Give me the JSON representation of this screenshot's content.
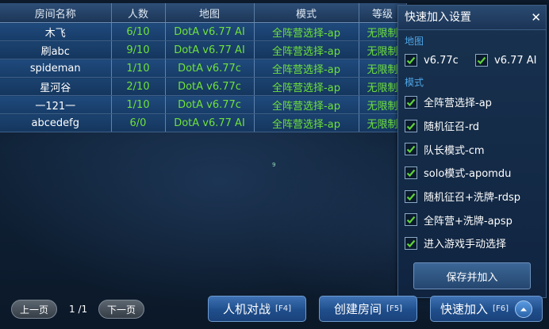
{
  "table": {
    "headers": [
      "房间名称",
      "人数",
      "地图",
      "模式",
      "等级"
    ],
    "rows": [
      {
        "name": "木飞",
        "players": "6/10",
        "map": "DotA v6.77 AI",
        "mode": "全阵营选择-ap",
        "level": "无限制"
      },
      {
        "name": "刷abc",
        "players": "9/10",
        "map": "DotA v6.77 AI",
        "mode": "全阵营选择-ap",
        "level": "无限制"
      },
      {
        "name": "spideman",
        "players": "1/10",
        "map": "DotA v6.77c",
        "mode": "全阵营选择-ap",
        "level": "无限制"
      },
      {
        "name": "星河谷",
        "players": "2/10",
        "map": "DotA v6.77c",
        "mode": "全阵营选择-ap",
        "level": "无限制"
      },
      {
        "name": "一121一",
        "players": "1/10",
        "map": "DotA v6.77c",
        "mode": "全阵营选择-ap",
        "level": "无限制"
      },
      {
        "name": "abcedefg",
        "players": "6/0",
        "map": "DotA v6.77 AI",
        "mode": "全阵营选择-ap",
        "level": "无限制"
      }
    ]
  },
  "watermark": "9",
  "panel": {
    "title": "快速加入设置",
    "close": "✕",
    "map_section": "地图",
    "maps": [
      {
        "label": "v6.77c",
        "checked": true
      },
      {
        "label": "v6.77 AI",
        "checked": true
      }
    ],
    "mode_section": "模式",
    "modes": [
      {
        "label": "全阵营选择-ap",
        "checked": true
      },
      {
        "label": "随机征召-rd",
        "checked": true
      },
      {
        "label": "队长模式-cm",
        "checked": true
      },
      {
        "label": "solo模式-apomdu",
        "checked": true
      },
      {
        "label": "随机征召+洗牌-rdsp",
        "checked": true
      },
      {
        "label": "全阵营+洗牌-apsp",
        "checked": true
      },
      {
        "label": "进入游戏手动选择",
        "checked": true
      }
    ],
    "save_button": "保存并加入"
  },
  "bottom": {
    "prev": "上一页",
    "page": "1 /1",
    "next": "下一页",
    "vs_ai": "人机对战",
    "vs_ai_key": "[F4]",
    "create_room": "创建房间",
    "create_room_key": "[F5]",
    "quick_join": "快速加入",
    "quick_join_key": "[F6]"
  },
  "colors": {
    "accent_green": "#6fe13a",
    "section_blue": "#4fa6e8",
    "check_green": "#5fd23a"
  }
}
